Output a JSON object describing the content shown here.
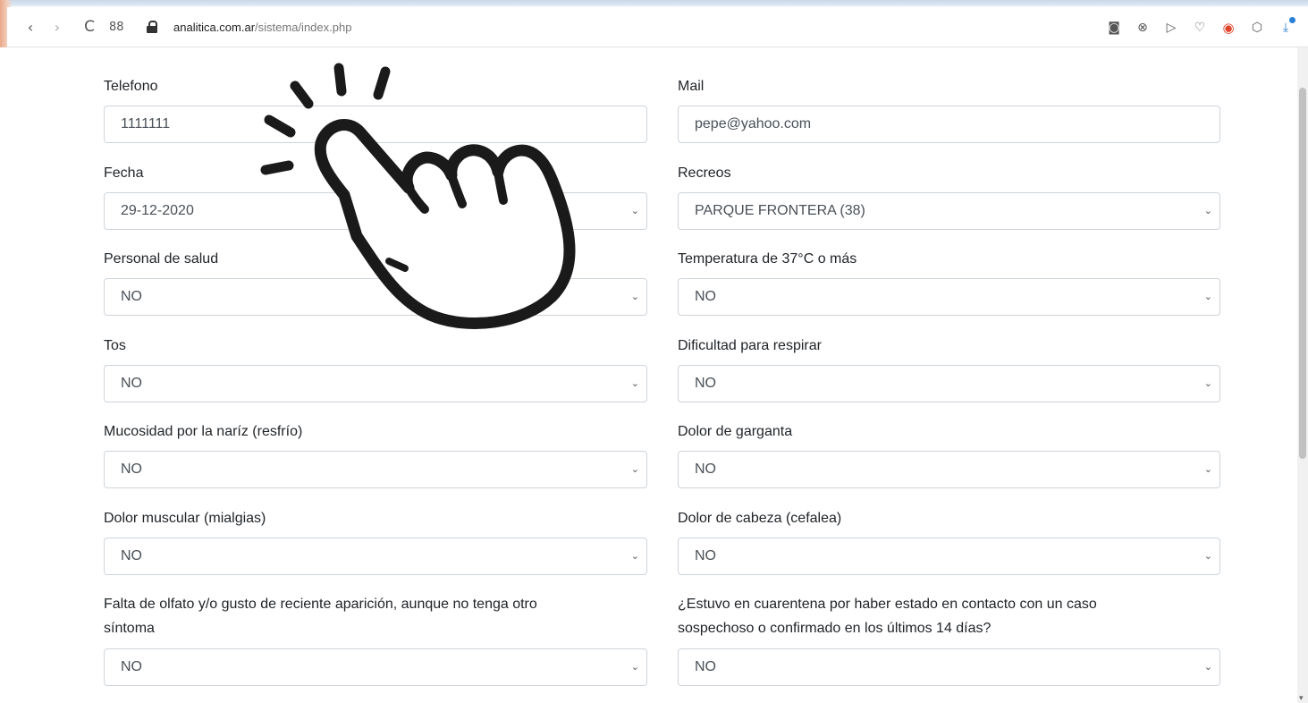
{
  "browser": {
    "back": "‹",
    "forward": "›",
    "reload": "C",
    "apps": "88",
    "url_domain": "analitica.com.ar",
    "url_path": "/sistema/index.php",
    "right_icons": [
      "camera-icon",
      "close-circle-icon",
      "send-icon",
      "heart-icon",
      "record-icon",
      "cube-icon",
      "download-icon"
    ]
  },
  "form": {
    "fields": [
      {
        "label": "Telefono",
        "value": "1111111",
        "type": "input"
      },
      {
        "label": "Mail",
        "value": "pepe@yahoo.com",
        "type": "input"
      },
      {
        "label": "Fecha",
        "value": "29-12-2020",
        "type": "select"
      },
      {
        "label": "Recreos",
        "value": "PARQUE FRONTERA (38)",
        "type": "select"
      },
      {
        "label": "Personal de salud",
        "value": "NO",
        "type": "select"
      },
      {
        "label": "Temperatura de 37°C o más",
        "value": "NO",
        "type": "select"
      },
      {
        "label": "Tos",
        "value": "NO",
        "type": "select"
      },
      {
        "label": "Dificultad para respirar",
        "value": "NO",
        "type": "select"
      },
      {
        "label": "Mucosidad por la naríz (resfrío)",
        "value": "NO",
        "type": "select"
      },
      {
        "label": "Dolor de garganta",
        "value": "NO",
        "type": "select"
      },
      {
        "label": "Dolor muscular (mialgias)",
        "value": "NO",
        "type": "select"
      },
      {
        "label": "Dolor de cabeza (cefalea)",
        "value": "NO",
        "type": "select"
      },
      {
        "label": "Falta de olfato y/o gusto de reciente aparición, aunque no tenga otro",
        "label2": "síntoma",
        "value": "NO",
        "type": "select"
      },
      {
        "label": "¿Estuvo en cuarentena por haber estado en contacto con un caso",
        "label2": "sospechoso o confirmado en los últimos 14 días?",
        "value": "NO",
        "type": "select"
      }
    ]
  },
  "overlay": {
    "icon": "pointing-hand-click-icon"
  },
  "colors": {
    "border": "#ced4da",
    "text": "#212529",
    "value_text": "#495057"
  }
}
